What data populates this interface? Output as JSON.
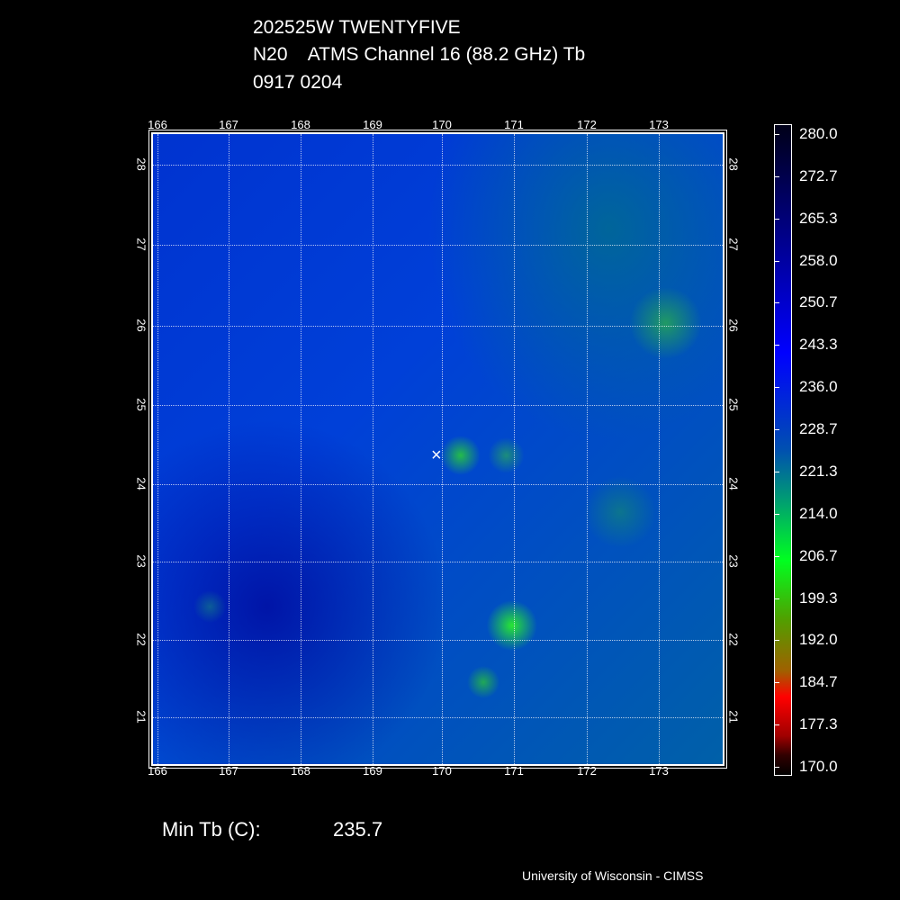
{
  "title": {
    "line1": "202525W TWENTYFIVE",
    "line2": "N20    ATMS Channel 16 (88.2 GHz) Tb",
    "line3": "0917 0204"
  },
  "lon_ticks": [
    "166",
    "167",
    "168",
    "169",
    "170",
    "171",
    "172",
    "173"
  ],
  "lat_ticks": [
    "28",
    "27",
    "26",
    "25",
    "24",
    "23",
    "22",
    "21"
  ],
  "colorbar": {
    "labels": [
      "280.0",
      "272.7",
      "265.3",
      "258.0",
      "250.7",
      "243.3",
      "236.0",
      "228.7",
      "221.3",
      "214.0",
      "206.7",
      "199.3",
      "192.0",
      "184.7",
      "177.3",
      "170.0"
    ]
  },
  "stats": {
    "label": "Min Tb (C):",
    "value": "235.7"
  },
  "footer": "University of Wisconsin - CIMSS",
  "center_marker": "x-mark"
}
